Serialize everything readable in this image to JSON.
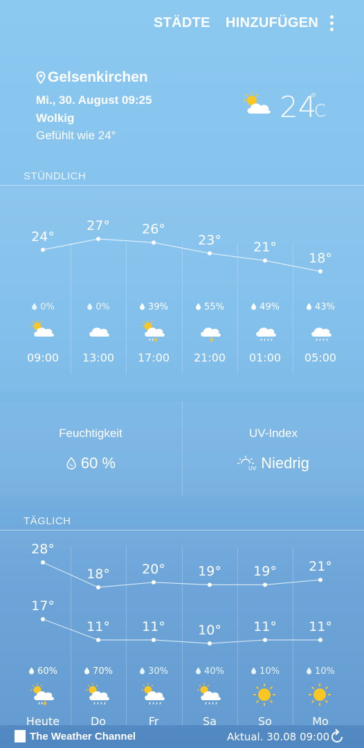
{
  "toolbar": {
    "cities_label": "STÄDTE",
    "add_label": "HINZUFÜGEN",
    "menu_icon": "more-vert-icon"
  },
  "current": {
    "location": "Gelsenkirchen",
    "datetime": "Mi., 30. August 09:25",
    "condition": "Wolkig",
    "feels_like": "Gefühlt wie 24°",
    "temp": "24",
    "deg": "°",
    "unit": "C",
    "icon": "partly-cloudy-icon"
  },
  "hourly": {
    "label": "STÜNDLICH",
    "items": [
      {
        "temp": "24°",
        "temp_value": 24,
        "precip": "0%",
        "precip_strong": false,
        "icon": "partly-cloudy-icon",
        "time": "09:00"
      },
      {
        "temp": "27°",
        "temp_value": 27,
        "precip": "0%",
        "precip_strong": false,
        "icon": "cloudy-icon",
        "time": "13:00"
      },
      {
        "temp": "26°",
        "temp_value": 26,
        "precip": "39%",
        "precip_strong": true,
        "icon": "thunder-rain-sun-icon",
        "time": "17:00"
      },
      {
        "temp": "23°",
        "temp_value": 23,
        "precip": "55%",
        "precip_strong": true,
        "icon": "thunder-cloud-icon",
        "time": "21:00"
      },
      {
        "temp": "21°",
        "temp_value": 21,
        "precip": "49%",
        "precip_strong": true,
        "icon": "rain-cloud-icon",
        "time": "01:00"
      },
      {
        "temp": "18°",
        "temp_value": 18,
        "precip": "43%",
        "precip_strong": true,
        "icon": "rain-cloud-icon",
        "time": "05:00"
      }
    ]
  },
  "details": {
    "humidity_title": "Feuchtigkeit",
    "humidity_value": "60 %",
    "humidity_icon": "humidity-drop-icon",
    "uv_title": "UV-Index",
    "uv_value": "Niedrig",
    "uv_icon": "uv-sun-icon"
  },
  "daily": {
    "label": "TÄGLICH",
    "items": [
      {
        "day": "Heute",
        "high": "28°",
        "high_value": 28,
        "low": "17°",
        "low_value": 17,
        "precip": "60%",
        "precip_strong": true,
        "icon": "thunder-rain-sun-icon"
      },
      {
        "day": "Do",
        "high": "18°",
        "high_value": 18,
        "low": "11°",
        "low_value": 11,
        "precip": "70%",
        "precip_strong": true,
        "icon": "rain-sun-icon"
      },
      {
        "day": "Fr",
        "high": "20°",
        "high_value": 20,
        "low": "11°",
        "low_value": 11,
        "precip": "30%",
        "precip_strong": false,
        "icon": "rain-sun-icon"
      },
      {
        "day": "Sa",
        "high": "19°",
        "high_value": 19,
        "low": "10°",
        "low_value": 10,
        "precip": "40%",
        "precip_strong": false,
        "icon": "rain-sun-icon"
      },
      {
        "day": "So",
        "high": "19°",
        "high_value": 19,
        "low": "11°",
        "low_value": 11,
        "precip": "10%",
        "precip_strong": false,
        "icon": "sun-icon"
      },
      {
        "day": "Mo",
        "high": "21°",
        "high_value": 21,
        "low": "11°",
        "low_value": 11,
        "precip": "10%",
        "precip_strong": false,
        "icon": "sun-icon"
      }
    ]
  },
  "footer": {
    "provider": "The Weather Channel",
    "updated": "Aktual.  30.08  09:00",
    "refresh_icon": "refresh-icon"
  }
}
